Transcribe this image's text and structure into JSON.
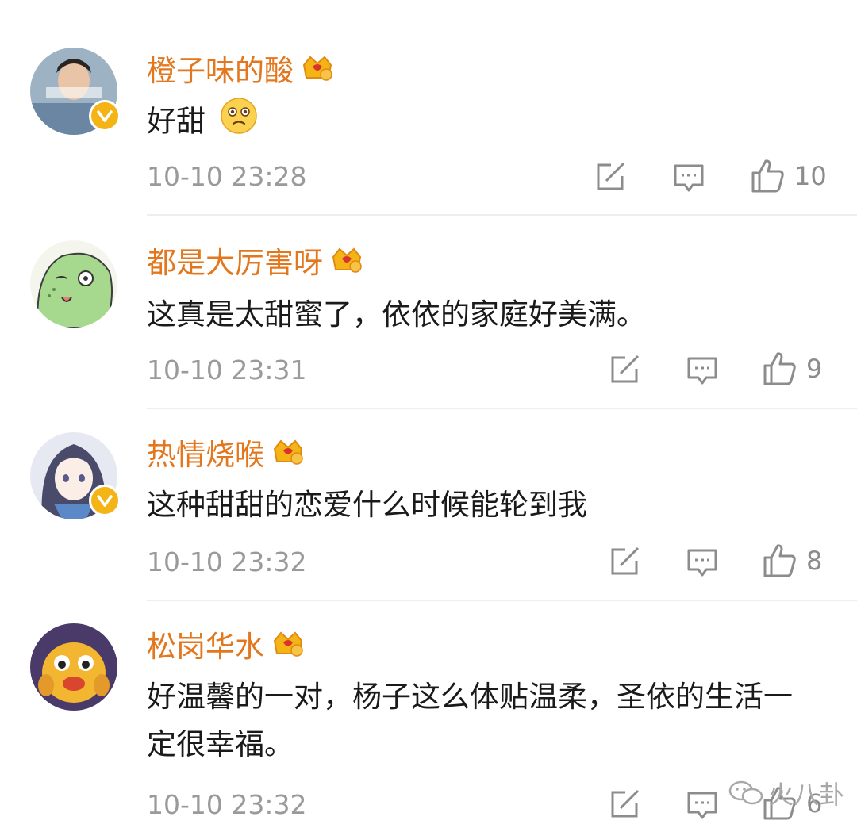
{
  "comments": [
    {
      "username": "橙子味的酸",
      "crown_level": "5",
      "text": "好甜",
      "emoji": "sad-face-emoji",
      "time": "10-10 23:28",
      "likes": "10",
      "verified": true
    },
    {
      "username": "都是大厉害呀",
      "crown_level": "2",
      "text": "这真是太甜蜜了，依依的家庭好美满。",
      "time": "10-10 23:31",
      "likes": "9",
      "verified": false
    },
    {
      "username": "热情烧喉",
      "crown_level": "2",
      "text": "这种甜甜的恋爱什么时候能轮到我",
      "time": "10-10 23:32",
      "likes": "8",
      "verified": true
    },
    {
      "username": "松岗华水",
      "crown_level": "1",
      "text": "好温馨的一对，杨子这么体贴温柔，圣依的生活一定很幸福。",
      "time": "10-10 23:32",
      "likes": "6",
      "verified": false
    }
  ],
  "watermark": {
    "label": "火八卦"
  },
  "colors": {
    "username": "#e3771d",
    "badge": "#f4b416",
    "timestamp": "#9a9a9a"
  }
}
